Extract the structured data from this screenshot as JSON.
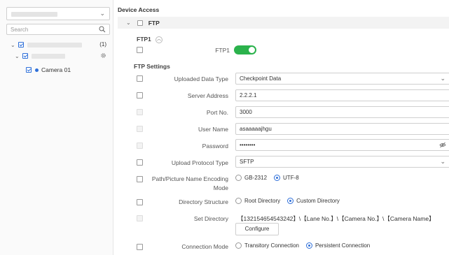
{
  "sidebar": {
    "search_placeholder": "Search",
    "tree": {
      "root_count": "(1)",
      "camera_label": "Camera 01"
    }
  },
  "main": {
    "title": "Device Access",
    "ftp_bar_label": "FTP",
    "ftp1_section": "FTP1",
    "ftp1_toggle_label": "FTP1",
    "ftp1_toggle_on": true,
    "settings_title": "FTP Settings",
    "fields": {
      "uploaded_data_type": {
        "label": "Uploaded Data Type",
        "value": "Checkpoint Data"
      },
      "server_address": {
        "label": "Server Address",
        "value": "2.2.2.1"
      },
      "port_no": {
        "label": "Port No.",
        "value": "3000"
      },
      "user_name": {
        "label": "User Name",
        "value": "asaaaaajhgu"
      },
      "password": {
        "label": "Password",
        "value": "••••••••"
      },
      "upload_protocol_type": {
        "label": "Upload Protocol Type",
        "value": "SFTP"
      }
    },
    "encoding": {
      "label_line1": "Path/Picture Name Encoding",
      "label_line2": "Mode",
      "options": [
        "GB-2312",
        "UTF-8"
      ],
      "selected": "UTF-8"
    },
    "directory_structure": {
      "label": "Directory Structure",
      "options": [
        "Root Directory",
        "Custom Directory"
      ],
      "selected": "Custom Directory"
    },
    "set_directory": {
      "label": "Set Directory",
      "value": "【132154654543242】\\【Lane No.】\\【Camera No.】\\【Camera Name】",
      "button": "Configure"
    },
    "connection_mode": {
      "label": "Connection Mode",
      "options": [
        "Transitory Connection",
        "Persistent Connection"
      ],
      "selected": "Persistent Connection"
    }
  },
  "colors": {
    "accent": "#2e6fd9",
    "toggle_on": "#2bb24c"
  }
}
